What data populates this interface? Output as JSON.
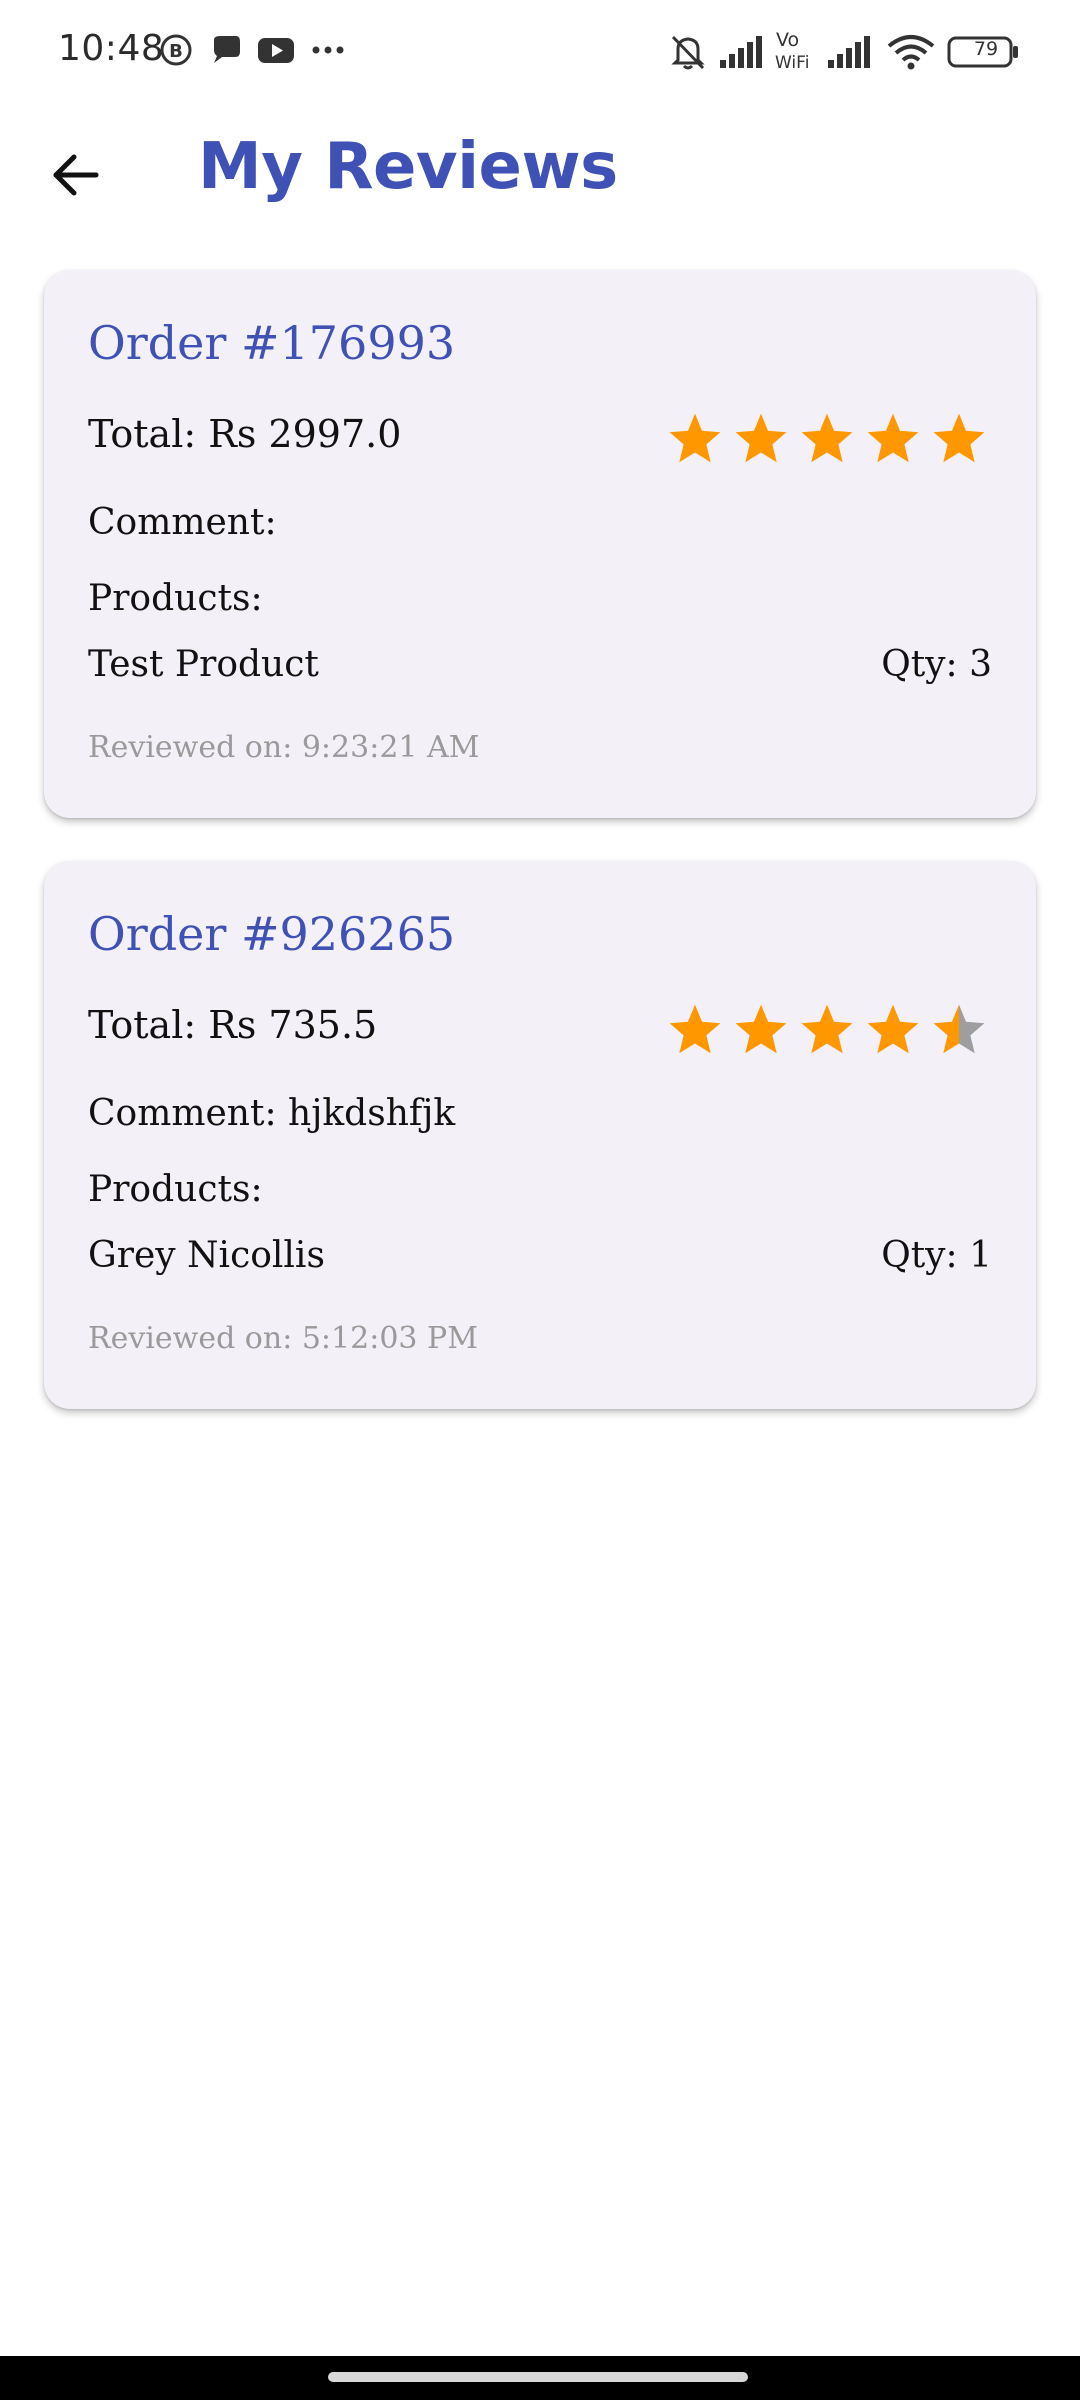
{
  "status_bar": {
    "time": "10:48",
    "battery": "79",
    "left_icons": [
      "b-circle-icon",
      "chat-bubble-icon",
      "youtube-icon",
      "more-dots-icon"
    ],
    "right_icons": [
      "bell-off-icon",
      "signal-icon",
      "vowifi-icon",
      "signal-icon",
      "wifi-icon",
      "battery-icon"
    ]
  },
  "header": {
    "title": "My Reviews",
    "back_icon": "arrow-left-icon"
  },
  "colors": {
    "accent": "#3f51b5",
    "card_bg": "#f4f0f8",
    "star_filled": "#ff9800",
    "star_empty": "#9e9e9e",
    "muted_text": "#9a9a9a"
  },
  "reviews": [
    {
      "order": "Order #176993",
      "total": "Total: Rs 2997.0",
      "rating": 5,
      "comment": "Comment:",
      "products_label": "Products:",
      "product_name": "Test Product",
      "product_qty": "Qty: 3",
      "reviewed_on": "Reviewed on: 9:23:21 AM"
    },
    {
      "order": "Order #926265",
      "total": "Total: Rs 735.5",
      "rating": 4.5,
      "comment": "Comment: hjkdshfjk",
      "products_label": "Products:",
      "product_name": "Grey Nicollis",
      "product_qty": "Qty: 1",
      "reviewed_on": "Reviewed on: 5:12:03 PM"
    }
  ]
}
